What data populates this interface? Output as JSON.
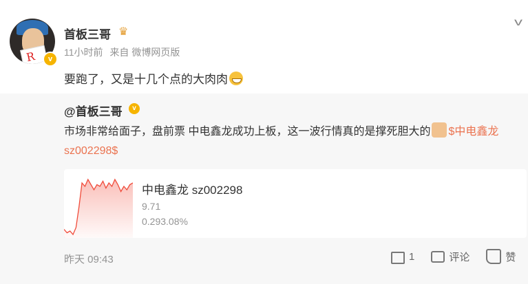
{
  "post": {
    "username": "首板三哥",
    "badge_icon": "crown-badge-icon",
    "time": "11小时前",
    "source": "来自 微博网页版",
    "text": "要跑了，又是十几个点的大肉肉",
    "emoji": "grin-emoji-icon"
  },
  "repost": {
    "username": "@首板三哥",
    "text_main": "市场非常给面子，盘前票 中电鑫龙成功上板，这一波行情真的是撑死胆大的",
    "topic": "$中电鑫龙 sz002298$",
    "stock": {
      "name": "中电鑫龙 sz002298",
      "price": "9.71",
      "change": "0.293.08%"
    },
    "time": "昨天 09:43",
    "share_count": "1",
    "comment_label": "评论",
    "like_label": "赞"
  },
  "colors": {
    "topic": "#eb7350",
    "verified": "#f6b400",
    "chart_line": "#f04b3a"
  },
  "chart_data": {
    "type": "line",
    "series": [
      {
        "values": [
          5,
          3,
          4,
          2,
          6,
          18,
          32,
          30,
          34,
          31,
          28,
          31,
          30,
          33,
          29,
          32,
          30,
          34,
          31,
          27,
          30,
          28,
          31,
          32
        ]
      }
    ],
    "ylim": [
      0,
      40
    ]
  }
}
